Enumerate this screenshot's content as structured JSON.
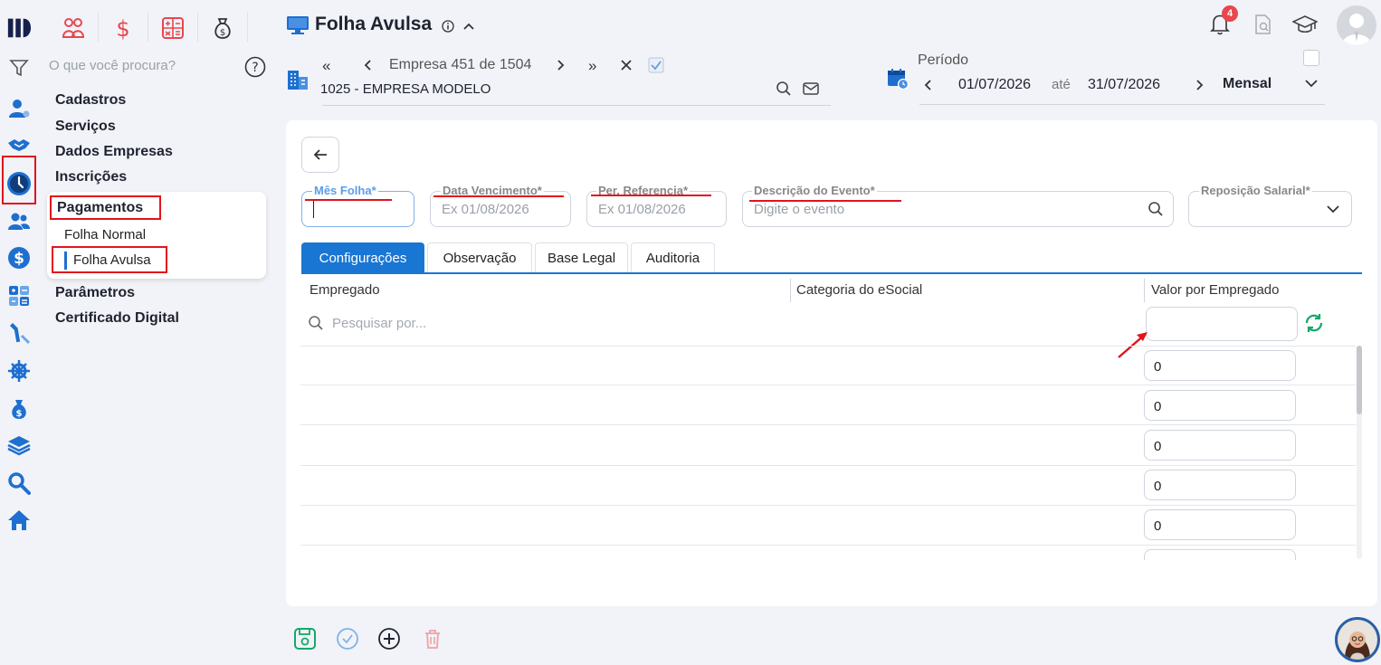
{
  "app": {
    "title": "Folha Avulsa",
    "notification_count": "4",
    "search_placeholder": "O que você procura?"
  },
  "company_bar": {
    "nav_text": "Empresa 451 de 1504",
    "company_name": "1025 - EMPRESA MODELO"
  },
  "period": {
    "label": "Período",
    "start": "01/07/2026",
    "separator": "até",
    "end": "31/07/2026",
    "mode": "Mensal"
  },
  "menu": {
    "items": [
      "Cadastros",
      "Serviços",
      "Dados Empresas",
      "Inscrições"
    ],
    "pagamentos": "Pagamentos",
    "sub_items": [
      "Folha Normal",
      "Folha Avulsa"
    ],
    "items_after": [
      "Parâmetros",
      "Certificado Digital"
    ]
  },
  "form": {
    "mes_folha_label": "Mês Folha*",
    "data_vencimento_label": "Data Vencimento*",
    "data_vencimento_placeholder": "Ex 01/08/2026",
    "per_referencia_label": "Per. Referencia*",
    "per_referencia_placeholder": "Ex 01/08/2026",
    "descricao_label": "Descrição do Evento*",
    "descricao_placeholder": "Digite o evento",
    "reposicao_label": "Reposição Salarial*"
  },
  "tabs": [
    "Configurações",
    "Observação",
    "Base Legal",
    "Auditoria"
  ],
  "table": {
    "headers": [
      "Empregado",
      "Categoria do eSocial",
      "Valor por Empregado"
    ],
    "search_placeholder": "Pesquisar por...",
    "values": [
      "0",
      "0",
      "0",
      "0",
      "0"
    ]
  },
  "colors": {
    "accent": "#1976d2",
    "annotation": "#e0141e",
    "save_green": "#16a86a"
  }
}
